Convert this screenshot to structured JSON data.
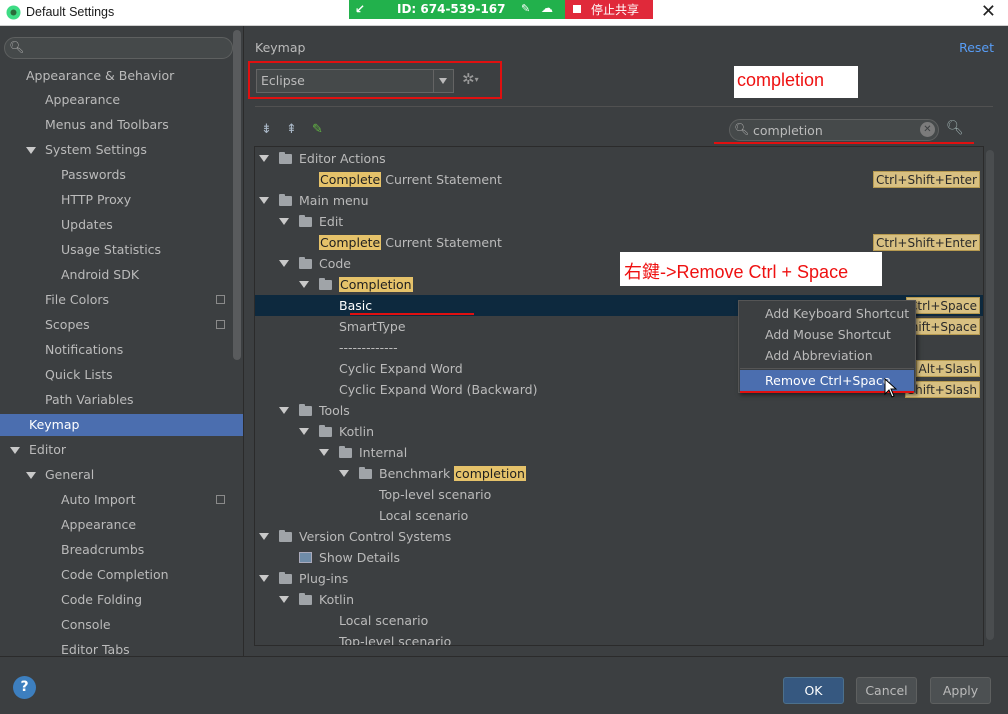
{
  "window": {
    "title": "Default Settings",
    "close_glyph": "✕"
  },
  "banner": {
    "arrow_glyph": "↙",
    "id_text": "ID: 674-539-167",
    "mic_glyph": "✎",
    "cloud_glyph": "☁",
    "stop_text": "停止共享"
  },
  "sidebar": {
    "items": [
      {
        "label": "Appearance & Behavior"
      },
      {
        "label": "Appearance"
      },
      {
        "label": "Menus and Toolbars"
      },
      {
        "label": "System Settings"
      },
      {
        "label": "Passwords"
      },
      {
        "label": "HTTP Proxy"
      },
      {
        "label": "Updates"
      },
      {
        "label": "Usage Statistics"
      },
      {
        "label": "Android SDK"
      },
      {
        "label": "File Colors"
      },
      {
        "label": "Scopes"
      },
      {
        "label": "Notifications"
      },
      {
        "label": "Quick Lists"
      },
      {
        "label": "Path Variables"
      },
      {
        "label": "Keymap"
      },
      {
        "label": "Editor"
      },
      {
        "label": "General"
      },
      {
        "label": "Auto Import"
      },
      {
        "label": "Appearance"
      },
      {
        "label": "Breadcrumbs"
      },
      {
        "label": "Code Completion"
      },
      {
        "label": "Code Folding"
      },
      {
        "label": "Console"
      },
      {
        "label": "Editor Tabs"
      }
    ]
  },
  "main": {
    "title": "Keymap",
    "reset_label": "Reset",
    "keymap_value": "Eclipse",
    "gear_glyph": "✲",
    "filter_value": "completion",
    "toolbar": {
      "expand_glyph": "⇟",
      "collapse_glyph": "⇞",
      "edit_glyph": "✎"
    }
  },
  "annotations": {
    "completion_note": "completion",
    "remove_note": "右鍵->Remove Ctrl + Space"
  },
  "tree": {
    "rows": [
      {
        "parts": [
          {
            "t": "Editor Actions"
          }
        ]
      },
      {
        "parts": [
          {
            "t": "Complete",
            "hl": true
          },
          {
            "t": " Current Statement"
          }
        ],
        "shortcut": "Ctrl+Shift+Enter"
      },
      {
        "parts": [
          {
            "t": "Main menu"
          }
        ]
      },
      {
        "parts": [
          {
            "t": "Edit"
          }
        ]
      },
      {
        "parts": [
          {
            "t": "Complete",
            "hl": true
          },
          {
            "t": " Current Statement"
          }
        ],
        "shortcut": "Ctrl+Shift+Enter"
      },
      {
        "parts": [
          {
            "t": "Code"
          }
        ]
      },
      {
        "parts": [
          {
            "t": "Completion",
            "hl": true
          }
        ]
      },
      {
        "parts": [
          {
            "t": "Basic"
          }
        ],
        "shortcut": "Ctrl+Space"
      },
      {
        "parts": [
          {
            "t": "SmartType"
          }
        ],
        "shortcut": "Shift+Space"
      },
      {
        "parts": [
          {
            "t": "-------------"
          }
        ]
      },
      {
        "parts": [
          {
            "t": "Cyclic Expand Word"
          }
        ],
        "shortcut": "Alt+Slash"
      },
      {
        "parts": [
          {
            "t": "Cyclic Expand Word (Backward)"
          }
        ],
        "shortcut": "Shift+Slash"
      },
      {
        "parts": [
          {
            "t": "Tools"
          }
        ]
      },
      {
        "parts": [
          {
            "t": "Kotlin"
          }
        ]
      },
      {
        "parts": [
          {
            "t": "Internal"
          }
        ]
      },
      {
        "parts": [
          {
            "t": "Benchmark "
          },
          {
            "t": "completion",
            "hl": true
          }
        ]
      },
      {
        "parts": [
          {
            "t": "Top-level scenario"
          }
        ]
      },
      {
        "parts": [
          {
            "t": "Local scenario"
          }
        ]
      },
      {
        "parts": [
          {
            "t": "Version Control Systems"
          }
        ]
      },
      {
        "parts": [
          {
            "t": "Show Details"
          }
        ]
      },
      {
        "parts": [
          {
            "t": "Plug-ins"
          }
        ]
      },
      {
        "parts": [
          {
            "t": "Kotlin"
          }
        ]
      },
      {
        "parts": [
          {
            "t": "Local scenario"
          }
        ]
      },
      {
        "parts": [
          {
            "t": "Top-level scenario"
          }
        ]
      }
    ]
  },
  "context_menu": {
    "items": [
      "Add Keyboard Shortcut",
      "Add Mouse Shortcut",
      "Add Abbreviation",
      "Remove Ctrl+Space"
    ]
  },
  "buttons": {
    "ok": "OK",
    "cancel": "Cancel",
    "apply": "Apply",
    "help": "?"
  },
  "colors": {
    "accent": "#4b6eaf",
    "annotation_red": "#e01010",
    "highlight": "#e5c26a"
  }
}
